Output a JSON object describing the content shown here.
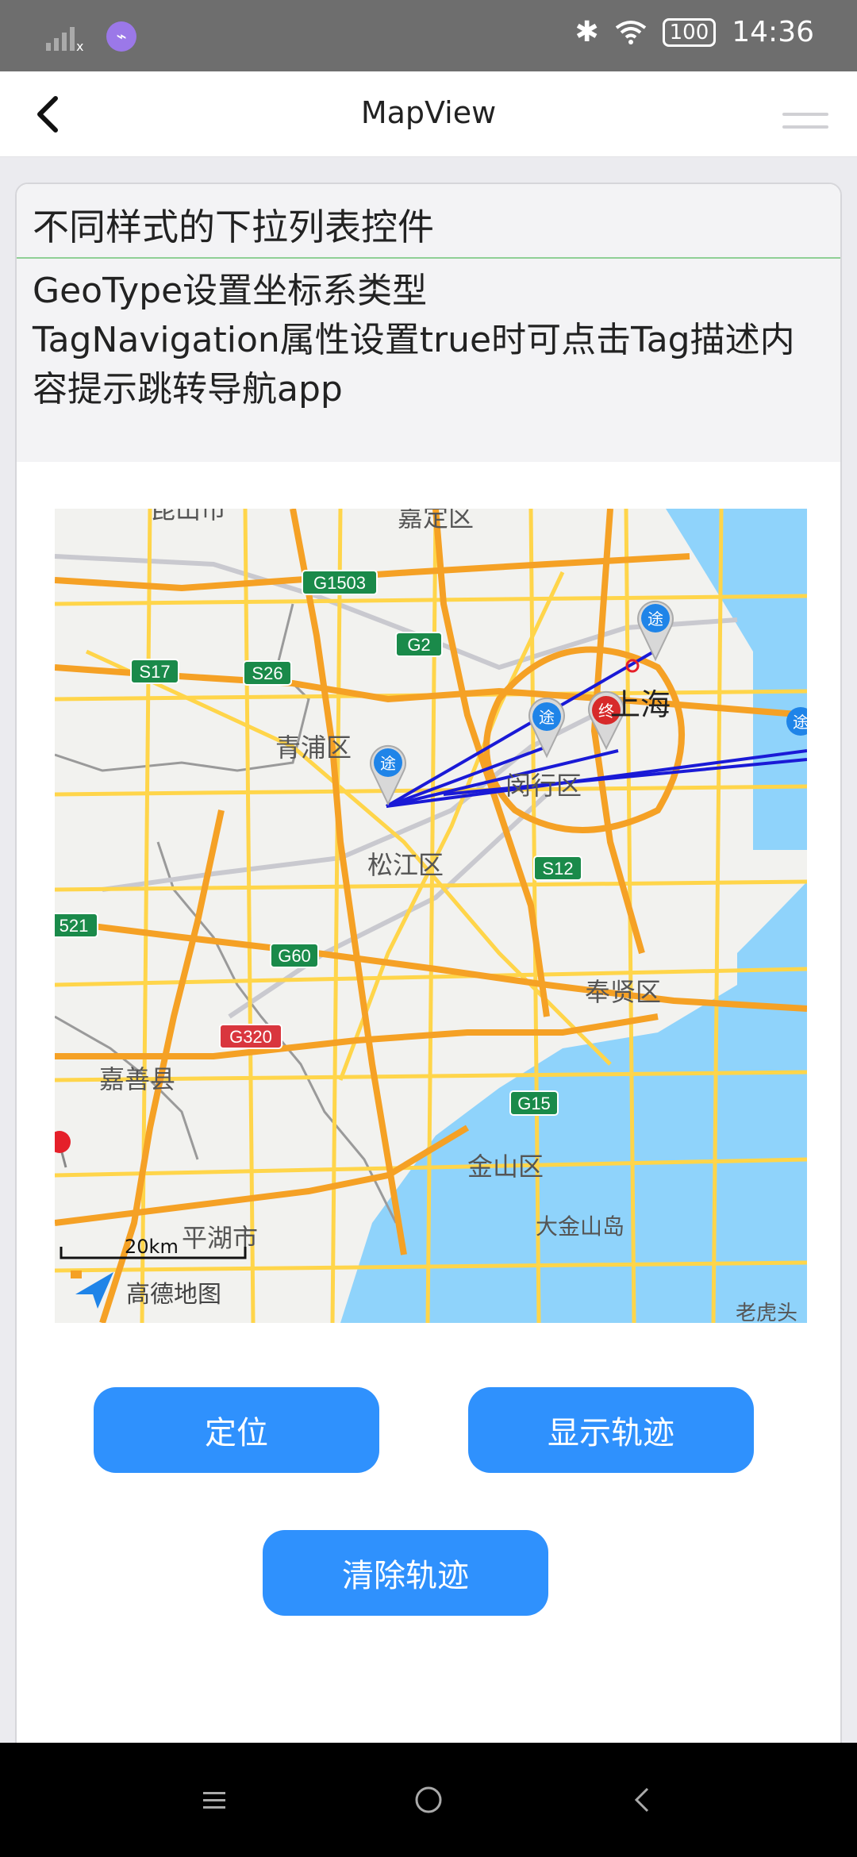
{
  "status": {
    "time": "14:36",
    "battery": "100"
  },
  "appbar": {
    "title": "MapView"
  },
  "card": {
    "header": "不同样式的下拉列表控件",
    "line1": "GeoType设置坐标系类型",
    "line2": "TagNavigation属性设置true时可点击Tag描述内容提示跳转导航app"
  },
  "map": {
    "labels": {
      "kunshan": "昆山市",
      "jiading": "嘉定区",
      "qingpu": "青浦区",
      "minhang": "闵行区",
      "shanghai": "上海",
      "songjiang": "松江区",
      "fengxian": "奉贤区",
      "jiashan": "嘉善县",
      "jinshan": "金山区",
      "pinghu": "平湖市",
      "dajinshan": "大金山岛",
      "laohutou": "老虎头"
    },
    "shields": {
      "g1503": "G1503",
      "g2": "G2",
      "s17": "S17",
      "s26": "S26",
      "s12": "S12",
      "g60": "G60",
      "g320": "G320",
      "g15": "G15",
      "s521": "521"
    },
    "markers": {
      "via": "途",
      "end": "终"
    },
    "scale": "20km",
    "brand": "高德地图"
  },
  "buttons": {
    "locate": "定位",
    "show_track": "显示轨迹",
    "clear_track": "清除轨迹"
  },
  "colors": {
    "accent": "#2f91fd",
    "track": "#1a1ad6",
    "water": "#8fd3fb"
  }
}
